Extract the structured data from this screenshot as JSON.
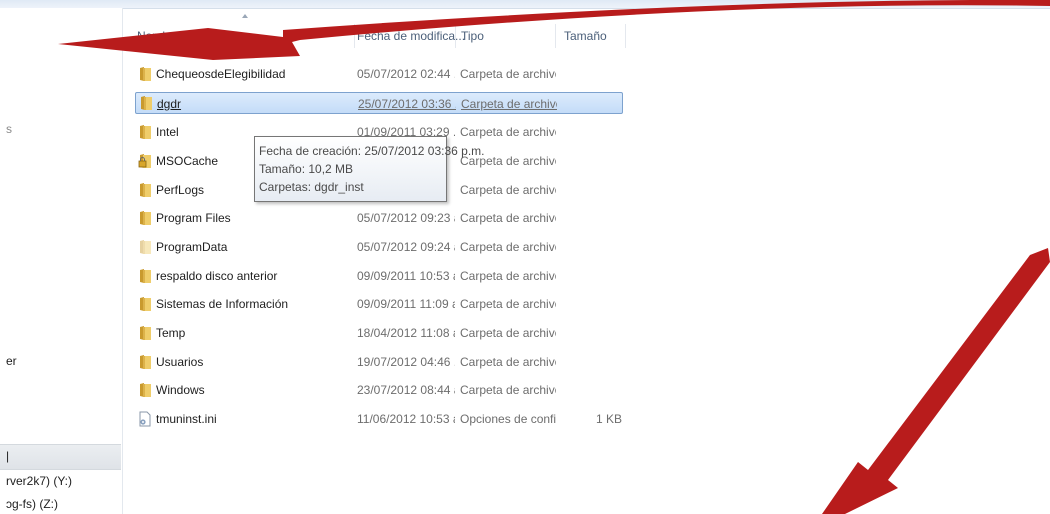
{
  "navigation": {
    "fragments": [
      {
        "text": "s"
      },
      {
        "text": "er"
      },
      {
        "text": "|"
      },
      {
        "text": "rver2k7) (Y:)"
      },
      {
        "text": "ɔg-fs) (Z:)"
      }
    ]
  },
  "columns": {
    "name": "Nombre",
    "date": "Fecha de modifica...",
    "type": "Tipo",
    "size": "Tamaño"
  },
  "files": [
    {
      "name": "ChequeosdeElegibilidad",
      "date": "05/07/2012 02:44 ...",
      "type": "Carpeta de archivos",
      "size": "",
      "icon": "folder-icon"
    },
    {
      "name": "dgdr",
      "date": "25/07/2012 03:36 ...",
      "type": "Carpeta de archivos",
      "size": "",
      "icon": "folder-icon",
      "selected": true
    },
    {
      "name": "Intel",
      "date": "01/09/2011 03:29 ...",
      "type": "Carpeta de archivos",
      "size": "",
      "icon": "folder-icon"
    },
    {
      "name": "MSOCache",
      "date": "",
      "type": "Carpeta de archivos",
      "size": "",
      "icon": "locked-folder-icon"
    },
    {
      "name": "PerfLogs",
      "date": "",
      "type": "Carpeta de archivos",
      "size": "",
      "icon": "folder-icon"
    },
    {
      "name": "Program Files",
      "date": "05/07/2012 09:23 a...",
      "type": "Carpeta de archivos",
      "size": "",
      "icon": "folder-icon"
    },
    {
      "name": "ProgramData",
      "date": "05/07/2012 09:24 a...",
      "type": "Carpeta de archivos",
      "size": "",
      "icon": "hidden-folder-icon"
    },
    {
      "name": "respaldo disco anterior",
      "date": "09/09/2011 10:53 a...",
      "type": "Carpeta de archivos",
      "size": "",
      "icon": "folder-icon"
    },
    {
      "name": "Sistemas de Información",
      "date": "09/09/2011 11:09 a...",
      "type": "Carpeta de archivos",
      "size": "",
      "icon": "folder-icon"
    },
    {
      "name": "Temp",
      "date": "18/04/2012 11:08 a...",
      "type": "Carpeta de archivos",
      "size": "",
      "icon": "folder-icon"
    },
    {
      "name": "Usuarios",
      "date": "19/07/2012 04:46 ...",
      "type": "Carpeta de archivos",
      "size": "",
      "icon": "folder-icon"
    },
    {
      "name": "Windows",
      "date": "23/07/2012 08:44 a...",
      "type": "Carpeta de archivos",
      "size": "",
      "icon": "folder-icon"
    },
    {
      "name": "tmuninst.ini",
      "date": "11/06/2012 10:53 a...",
      "type": "Opciones de confi...",
      "size": "1 KB",
      "icon": "ini-file-icon"
    }
  ],
  "tooltip": {
    "created": "Fecha de creación: 25/07/2012 03:36 p.m.",
    "size": "Tamaño: 10,2 MB",
    "folders": "Carpetas: dgdr_inst"
  },
  "colors": {
    "arrow": "#b81c1c",
    "folder": "#e8c35a",
    "selection": "#c4dcf8",
    "selection_border": "#7da2ce",
    "header_text": "#4c607a"
  }
}
